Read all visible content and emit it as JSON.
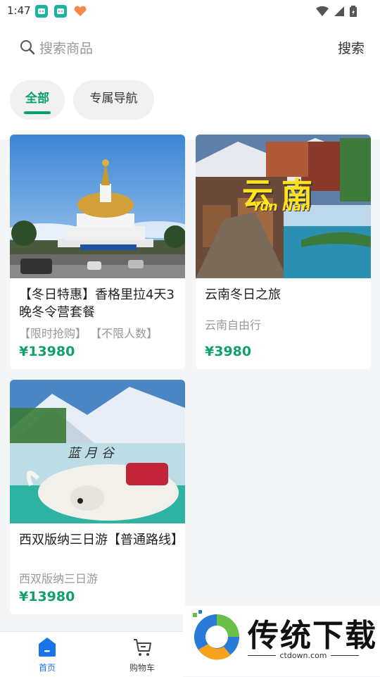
{
  "status_bar": {
    "time": "1:47"
  },
  "search": {
    "placeholder": "搜索商品",
    "button_label": "搜索"
  },
  "tabs": [
    {
      "label": "全部",
      "active": true
    },
    {
      "label": "专属导航",
      "active": false
    }
  ],
  "products": [
    {
      "title": "【冬日特惠】香格里拉4天3晚冬令营套餐",
      "subtitle": "【限时抢购】 【不限人数】",
      "price": "¥13980"
    },
    {
      "title": "云南冬日之旅",
      "subtitle": "云南自由行",
      "price": "¥3980",
      "image_text_main": "云南",
      "image_text_sub": "Yun Nan"
    },
    {
      "title": "西双版纳三日游【普通路线】",
      "subtitle": "西双版纳三日游",
      "price": "¥13980",
      "image_text_main": "蓝月谷"
    }
  ],
  "bottom_nav": [
    {
      "label": "首页",
      "icon": "home-icon",
      "active": true
    },
    {
      "label": "购物车",
      "icon": "cart-icon",
      "active": false
    }
  ],
  "watermark": {
    "title": "传统下载",
    "url": "ctdown.com"
  },
  "colors": {
    "accent": "#0aa069",
    "price": "#11a06a",
    "nav_active": "#1a73e8"
  }
}
